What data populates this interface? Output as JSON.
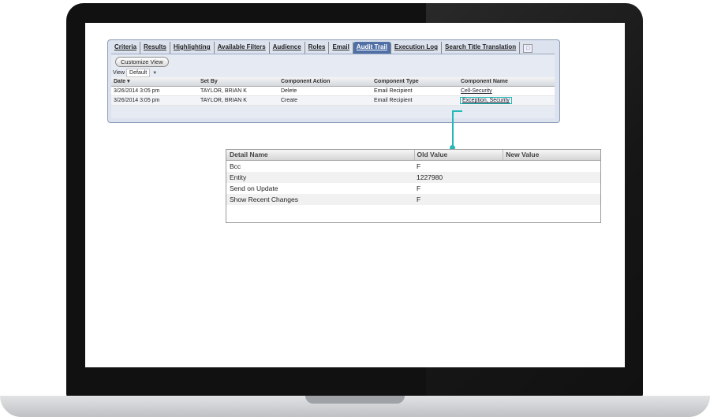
{
  "tabs": [
    "Criteria",
    "Results",
    "Highlighting",
    "Available Filters",
    "Audience",
    "Roles",
    "Email",
    "Audit Trail",
    "Execution Log",
    "Search Title Translation"
  ],
  "active_tab": "Audit Trail",
  "toolbar": {
    "customize_label": "Customize View",
    "view_label": "View",
    "view_value": "Default"
  },
  "audit_grid": {
    "headers": [
      "Date",
      "Set By",
      "Component Action",
      "Component Type",
      "Component Name"
    ],
    "rows": [
      [
        "3/26/2014 3:05 pm",
        "TAYLOR, BRIAN K",
        "Delete",
        "Email Recipient",
        "Cell-Security"
      ],
      [
        "3/26/2014 3:05 pm",
        "TAYLOR, BRIAN K",
        "Create",
        "Email Recipient",
        "Exception, Security"
      ]
    ]
  },
  "detail": {
    "headers": [
      "Detail Name",
      "Old Value",
      "New Value"
    ],
    "rows": [
      [
        "Bcc",
        "F",
        ""
      ],
      [
        "Entity",
        "1227980",
        ""
      ],
      [
        "Send on Update",
        "F",
        ""
      ],
      [
        "Show Recent Changes",
        "F",
        ""
      ]
    ]
  },
  "colors": {
    "highlight": "#26b7b7",
    "active_tab": "#4f6fa5"
  }
}
